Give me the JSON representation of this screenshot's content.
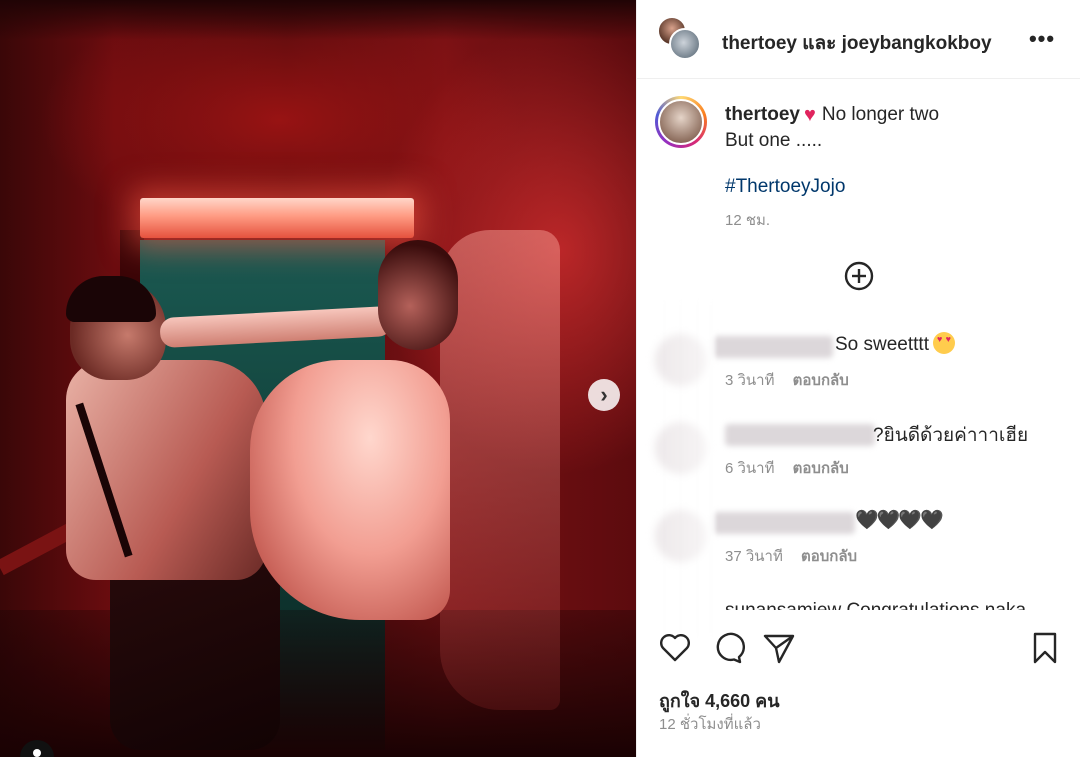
{
  "header": {
    "title": "thertoey และ joeybangkokboy",
    "more_icon": "more-horizontal-icon"
  },
  "caption": {
    "username": "thertoey",
    "text_line1": "No longer two",
    "text_line2": "But one .....",
    "hashtag": "#ThertoeyJojo",
    "time": "12 ชม."
  },
  "load_more_icon": "plus-circle-icon",
  "comments": [
    {
      "text": "So sweetttt",
      "time": "3 วินาที",
      "reply_label": "ตอบกลับ"
    },
    {
      "text": "?ยินดีด้วยค่าาาเฮีย",
      "time": "6 วินาที",
      "reply_label": "ตอบกลับ"
    },
    {
      "text": "🖤🖤🖤🖤",
      "time": "37 วินาที",
      "reply_label": "ตอบกลับ"
    }
  ],
  "partial_comment": "sunansamiew Congratulations naka",
  "actions": {
    "like_icon": "heart-icon",
    "comment_icon": "comment-icon",
    "share_icon": "send-icon",
    "save_icon": "bookmark-icon"
  },
  "likes_text": "ถูกใจ 4,660 คน",
  "posted_time": "12 ชั่วโมงที่แล้ว",
  "colors": {
    "text": "#262626",
    "muted": "#8e8e8e",
    "hashtag": "#00376b",
    "heart": "#e0245e"
  }
}
